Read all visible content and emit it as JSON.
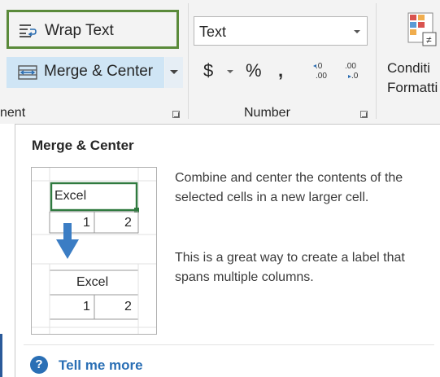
{
  "ribbon": {
    "wrap_text": "Wrap Text",
    "merge_center": "Merge & Center",
    "alignment_group_label": "nent",
    "number_format_value": "Text",
    "currency_symbol": "$",
    "percent_symbol": "%",
    "comma_symbol": ",",
    "increase_decimal": "←.0 .00",
    "decrease_decimal": ".00 →.0",
    "number_group_label": "Number",
    "conditional_formatting_line1": "Conditi",
    "conditional_formatting_line2": "Formatti"
  },
  "tooltip": {
    "title": "Merge & Center",
    "description": "Combine and center the contents of the selected cells in a new larger cell.",
    "tip": "This is a great way to create a label that spans multiple columns.",
    "help_link": "Tell me more",
    "illustration": {
      "before_label": "Excel",
      "before_cells": [
        "1",
        "2"
      ],
      "after_label": "Excel",
      "after_cells": [
        "1",
        "2"
      ]
    }
  },
  "colors": {
    "highlight_border": "#5a8a3a",
    "merge_hover": "#cfe5f5",
    "link": "#2a6fb5",
    "arrow": "#3b7dc4"
  }
}
